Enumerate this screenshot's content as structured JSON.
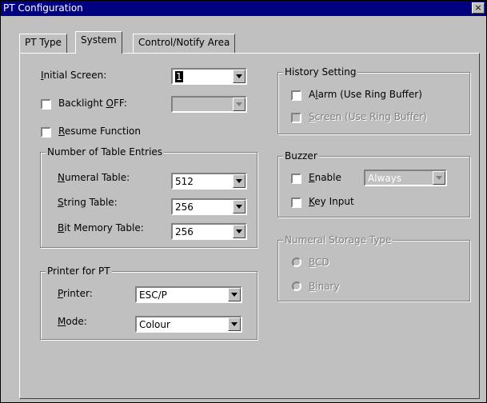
{
  "window": {
    "title": "PT Configuration",
    "close_glyph": "×"
  },
  "tabs": [
    {
      "label": "PT Type",
      "active": false
    },
    {
      "label": "System",
      "active": true
    },
    {
      "label": "Control/Notify Area",
      "active": false
    }
  ],
  "initial_screen": {
    "label_pre": "",
    "label_u": "I",
    "label_post": "nitial Screen:",
    "value": "1"
  },
  "backlight": {
    "label_pre": "Backlight ",
    "label_u": "O",
    "label_post": "FF:",
    "checked": false,
    "value": ""
  },
  "resume": {
    "label_pre": "",
    "label_u": "R",
    "label_post": "esume Function",
    "checked": false
  },
  "table_entries": {
    "title": "Number of Table Entries",
    "numeral": {
      "label_pre": "",
      "label_u": "N",
      "label_post": "umeral Table:",
      "value": "512"
    },
    "string": {
      "label_pre": "",
      "label_u": "S",
      "label_post": "tring Table:",
      "value": "256"
    },
    "bit_memory": {
      "label_pre": "",
      "label_u": "B",
      "label_post": "it Memory Table:",
      "value": "256"
    }
  },
  "printer": {
    "title": "Printer for PT",
    "printer": {
      "label_pre": "",
      "label_u": "P",
      "label_post": "rinter:",
      "value": "ESC/P"
    },
    "mode": {
      "label_pre": "",
      "label_u": "M",
      "label_post": "ode:",
      "value": "Colour"
    }
  },
  "history": {
    "title": "History Setting",
    "alarm": {
      "label_pre": "A",
      "label_u": "l",
      "label_post": "arm (Use Ring Buffer)",
      "checked": false,
      "enabled": true
    },
    "screen": {
      "label_pre": "",
      "label_u": "S",
      "label_post": "creen (Use Ring Buffer)",
      "checked": false,
      "enabled": false
    }
  },
  "buzzer": {
    "title": "Buzzer",
    "enable": {
      "label_pre": "",
      "label_u": "E",
      "label_post": "nable",
      "checked": false
    },
    "mode_value": "Always",
    "key_input": {
      "label_pre": "",
      "label_u": "K",
      "label_post": "ey Input",
      "checked": false
    }
  },
  "numeral_storage": {
    "title": "Numeral Storage Type",
    "bcd": {
      "label_pre": "",
      "label_u": "B",
      "label_post": "CD",
      "selected": false
    },
    "binary": {
      "label_pre": "",
      "label_u": "B",
      "label_post": "inary",
      "selected": false
    }
  }
}
